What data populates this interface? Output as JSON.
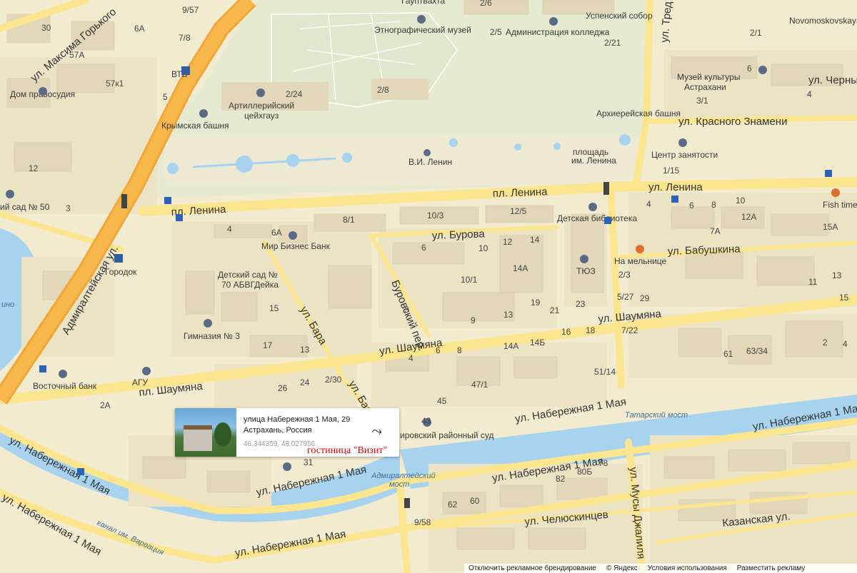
{
  "streets": {
    "admiralteyskaya": "Адмиралтейская ул.",
    "maksima_gorkogo": "ул. Максима Горького",
    "lenina_square_left": "пл. Ленина",
    "lenina_square_mid": "пл. Ленина",
    "lenina_right": "ул. Ленина",
    "burova": "ул. Бурова",
    "burovsky": "Буровский пер.",
    "bara_top": "ул. Бара",
    "bara_bottom": "ул. Бара",
    "shaumyana_left": "пл. Шаумяна",
    "shaumyana_mid": "ул. Шаумяна",
    "shaumyana_right": "ул. Шаумяна",
    "naberezhnaya_1": "ул. Набережная 1 Мая",
    "naberezhnaya_2": "ул. Набережная 1 Мая",
    "naberezhnaya_3": "ул. Набережная 1 Мая",
    "naberezhnaya_4": "ул. Набережная 1 Мая",
    "naberezhnaya_5": "ул. Набережная 1 Мая",
    "naberezhnaya_6": "ул. Набережная 1 Мая",
    "naberezhnaya_7": "ул. Набережная 1 Мая",
    "krasnogo_znameni": "ул. Красного Знамени",
    "babushkina": "ул. Бабушкина",
    "chelyuskintsev": "ул. Челюскинцев",
    "kazanskaya": "Казанская ул.",
    "musy_dzhalilya": "ул. Мусы Джалиля",
    "tred": "ул. Тред",
    "chernysh": "ул. Черныш",
    "novomoskovskaya": "Novomoskovskaya"
  },
  "water": {
    "canal": "канал им. Варвация",
    "tatar_bridge": "Татарский мост",
    "admiralty_bridge_1": "Адмиралтейский",
    "admiralty_bridge_2": "мост",
    "pond": "ино"
  },
  "places": {
    "ethnographic_museum": "Этнографический музей",
    "college_admin": "Администрация колледжа",
    "uspensky": "Успенский собор",
    "artillery_1": "Артиллерийский",
    "artillery_2": "цейхгауз",
    "crimean_tower": "Крымская башня",
    "archbishop_tower": "Архиерейская башня",
    "lenin_monument": "В.И. Ленин",
    "lenin_square_1": "площадь",
    "lenin_square_2": "им. Ленина",
    "vtb": "ВТБ",
    "house_of_justice": "Дом правосудия",
    "kindergarten50": "ий сад № 50",
    "gorodok": "Городок",
    "mir_biznes": "Мир Бизнес Банк",
    "detsad70_1": "Детский сад №",
    "detsad70_2": "70 АБВГДейка",
    "gymnasium3": "Гимназия № 3",
    "agu": "АГУ",
    "vostochny": "Восточный банк",
    "children_library": "Детская библиотека",
    "tyuz": "ТЮЗ",
    "na_melnitse": "На мельнице",
    "fish_time": "Fish time",
    "music_museum_1": "Музей культуры",
    "music_museum_2": "Астрахани",
    "employment": "Центр занятости",
    "court": "ировский районный суд",
    "hauptwache": "Гауптвахта"
  },
  "house_numbers": [
    "9/57",
    "30",
    "7/8",
    "6А",
    "57А",
    "57к1",
    "5",
    "2/6",
    "2/5",
    "2/21",
    "2/24",
    "2/8",
    "2/1",
    "6",
    "3/1",
    "4",
    "12",
    "3",
    "1/15",
    "8/1",
    "10/3",
    "12/5",
    "4",
    "6А",
    "6",
    "10",
    "12",
    "14",
    "14А",
    "10/1",
    "15",
    "3",
    "9",
    "13",
    "19",
    "21",
    "23",
    "17",
    "13",
    "4",
    "6",
    "8",
    "14А",
    "14Б",
    "16",
    "18",
    "47/1",
    "45",
    "43",
    "2/30",
    "26",
    "24",
    "1",
    "2А",
    "31",
    "62",
    "60",
    "82",
    "80Б",
    "78",
    "51/14",
    "5/27",
    "29",
    "7/22",
    "4",
    "6",
    "8",
    "10",
    "12А",
    "7А",
    "15А",
    "2/3",
    "11",
    "13",
    "15",
    "61",
    "63/34",
    "2",
    "4",
    "9/58"
  ],
  "card": {
    "address_line1": "улица Набережная 1 Мая, 29",
    "address_line2": "Астрахань, Россия",
    "coords": "46.344359, 48.027956"
  },
  "hotel_label": "гостиница \"Визит\"",
  "footer": {
    "ads_branding": "Отключить рекламное брендирование",
    "copyright": "© Яндекс",
    "terms": "Условия использования",
    "place_ads": "Разместить рекламу"
  },
  "colors": {
    "land": "#f3ebcf",
    "block": "#ece3c5",
    "building": "#e2d8b9",
    "park": "#e9edd2",
    "water": "#a8d3ee",
    "major_road": "#f7b74a",
    "minor_road": "#fbe58f",
    "hotel": "#e00000"
  }
}
